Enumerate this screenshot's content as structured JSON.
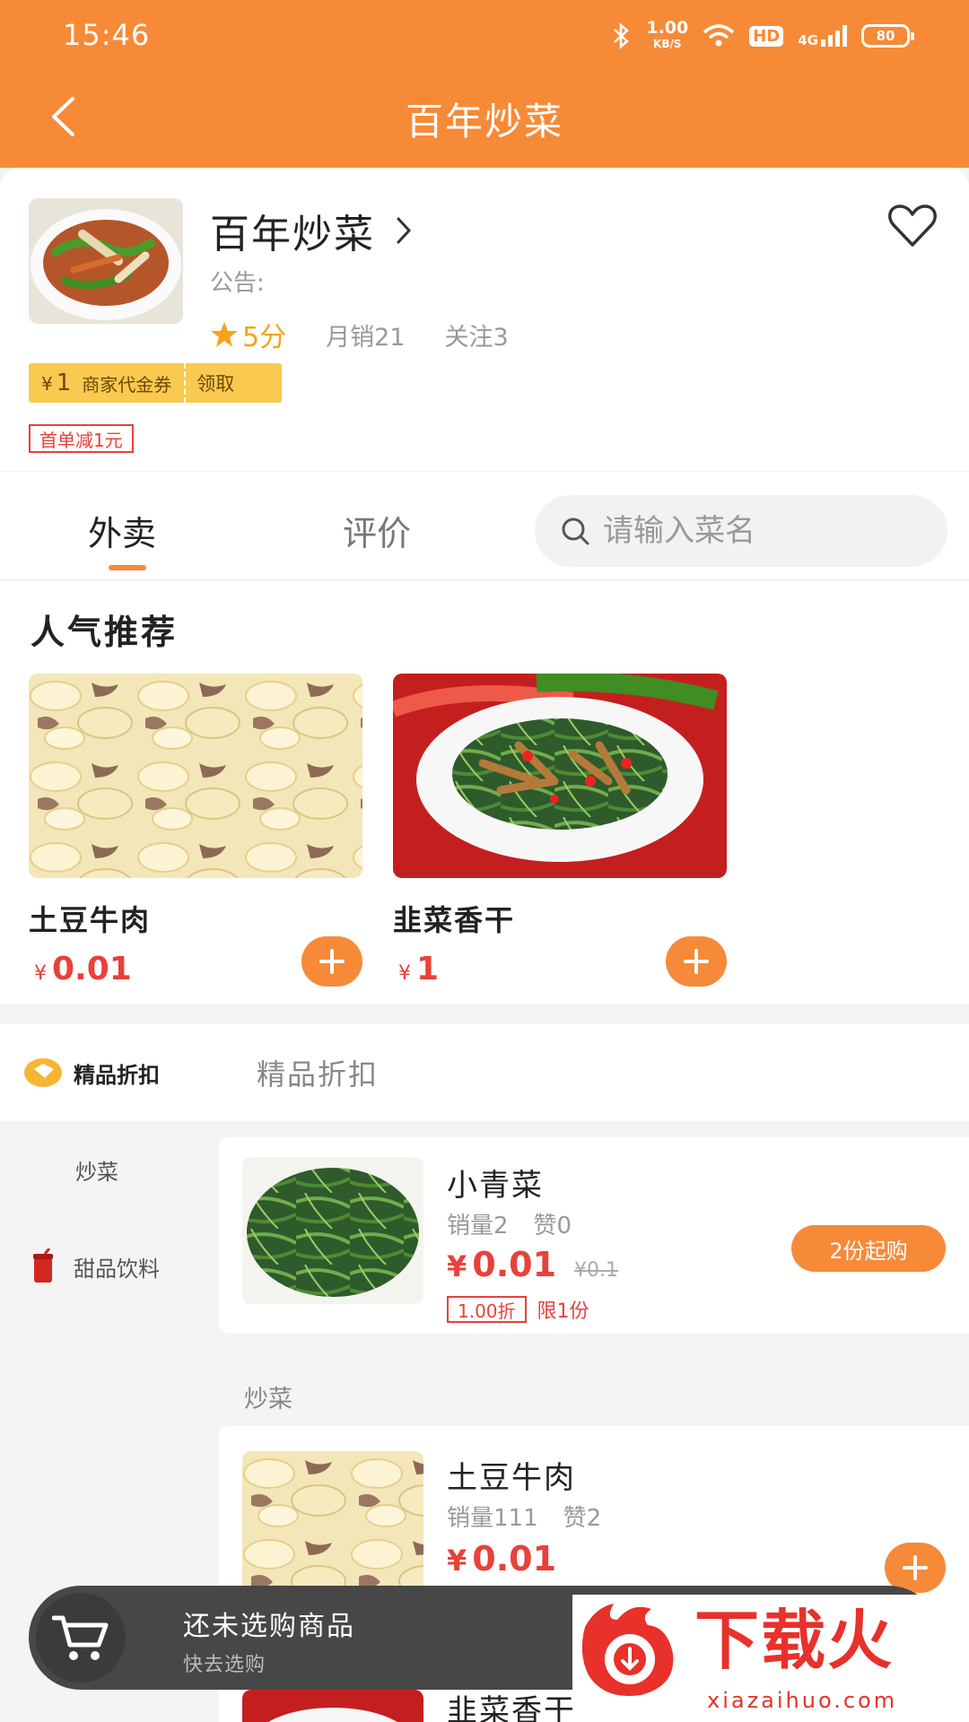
{
  "status_bar": {
    "time": "15:46",
    "speed_value": "1.00",
    "speed_unit": "KB/S",
    "hd": "HD",
    "network": "4G",
    "battery": "80"
  },
  "nav": {
    "title": "百年炒菜"
  },
  "shop": {
    "name": "百年炒菜",
    "notice": "公告:",
    "rating": "5分",
    "monthly_sales": "月销21",
    "followers": "关注3",
    "coupon": {
      "currency": "¥",
      "amount": "1",
      "text": "商家代金券",
      "claim": "领取"
    },
    "first_order": "首单减1元"
  },
  "tabs": {
    "takeout": "外卖",
    "reviews": "评价",
    "search_placeholder": "请输入菜名"
  },
  "popular": {
    "title": "人气推荐",
    "items": [
      {
        "name": "土豆牛肉",
        "currency": "¥",
        "price": "0.01"
      },
      {
        "name": "韭菜香干",
        "currency": "¥",
        "price": "1"
      }
    ]
  },
  "sidebar": {
    "items": [
      {
        "label": "精品折扣"
      },
      {
        "label": "炒菜"
      },
      {
        "label": "甜品饮料"
      }
    ]
  },
  "menu": {
    "section_title": "精品折扣",
    "category_label": "炒菜",
    "dishes": [
      {
        "name": "小青菜",
        "sales": "销量2",
        "likes": "赞0",
        "currency": "¥",
        "price": "0.01",
        "old_price": "¥0.1",
        "discount": "1.00折",
        "limit": "限1份",
        "min_buy": "2份起购"
      },
      {
        "name": "土豆牛肉",
        "sales": "销量111",
        "likes": "赞2",
        "currency": "¥",
        "price": "0.01"
      },
      {
        "name": "韭菜香干"
      }
    ]
  },
  "cart": {
    "empty_text": "还未选购商品",
    "hint": "快去选购"
  },
  "watermark": {
    "title": "下载火",
    "url": "xiazaihuo.com"
  },
  "colors": {
    "brand_orange": "#f78a37",
    "price_red": "#e8413a",
    "coupon_yellow": "#f9c950"
  }
}
